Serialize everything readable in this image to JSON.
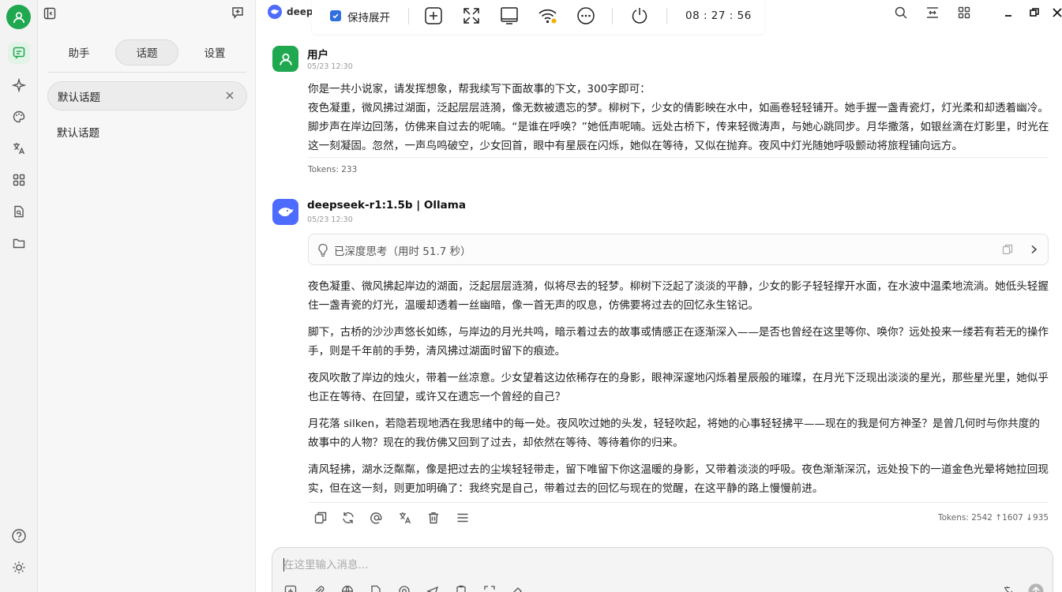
{
  "colors": {
    "accent_green": "#1fa84f",
    "accent_blue": "#2f6fde",
    "deepseek_blue": "#4d6bfe"
  },
  "header": {
    "tab_title": "deeps",
    "float_bar": {
      "keep_open_label": "保持展开",
      "keep_open_checked": true,
      "clock": "08 : 27 : 56"
    }
  },
  "sidebar": {
    "tabs": [
      {
        "label": "助手"
      },
      {
        "label": "话题",
        "active": true
      },
      {
        "label": "设置"
      }
    ],
    "topic_selected": "默认话题",
    "topics": [
      {
        "label": "默认话题"
      }
    ]
  },
  "messages": [
    {
      "sender": "用户",
      "time": "05/23 12:30",
      "paragraphs": [
        "你是一共小说家，请发挥想象，帮我续写下面故事的下文，300字即可：",
        "夜色凝重，微风拂过湖面，泛起层层涟漪，像无数被遗忘的梦。柳树下，少女的倩影映在水中，如画卷轻轻铺开。她手握一盏青瓷灯，灯光柔和却透着幽冷。脚步声在岸边回荡，仿佛来自过去的呢喃。“是谁在呼唤？”她低声呢喃。远处古桥下，传来轻微涛声，与她心跳同步。月华撒落，如银丝滴在灯影里，时光在这一刻凝固。忽然，一声鸟鸣破空，少女回首，眼中有星辰在闪烁，她似在等待，又似在抛弃。夜风中灯光随她呼吸颤动将旅程铺向远方。"
      ],
      "tokens": "Tokens: 233"
    },
    {
      "sender": "deepseek-r1:1.5b | Ollama",
      "time": "05/23 12:30",
      "thinking": "已深度思考（用时 51.7 秒）",
      "paragraphs": [
        "夜色凝重、微风拂起岸边的湖面，泛起层层涟漪，似将尽去的轻梦。柳树下泛起了淡淡的平静，少女的影子轻轻撑开水面，在水波中温柔地流淌。她低头轻握住一盏青瓷的灯光，温暖却透着一丝幽暗，像一首无声的叹息，仿佛要将过去的回忆永生铭记。",
        "脚下，古桥的沙沙声悠长如练，与岸边的月光共鸣，暗示着过去的故事或情感正在逐渐深入——是否也曾经在这里等你、唤你？远处投来一缕若有若无的操作手，则是千年前的手势，清风拂过湖面时留下的痕迹。",
        "夜风吹散了岸边的烛火，带着一丝凉意。少女望着这边依稀存在的身影，眼神深邃地闪烁着星辰般的璀璨，在月光下泛现出淡淡的星光，那些星光里，她似乎也正在等待、在回望，或许又在遗忘一个曾经的自己？",
        "月花落 silken，若隐若现地洒在我思绪中的每一处。夜风吹过她的头发，轻轻吹起，将她的心事轻轻拂平——现在的我是何方神圣？是曾几何时与你共度的故事中的人物？现在的我仿佛又回到了过去，却依然在等待、等待着你的归来。",
        "清风轻拂，湖水泛粼粼，像是把过去的尘埃轻轻带走，留下唯留下你这温暖的身影，又带着淡淡的呼吸。夜色渐渐深沉，远处投下的一道金色光晕将她拉回现实，但在这一刻，则更加明确了：我终究是自己，带着过去的回忆与现在的觉醒，在这平静的路上慢慢前进。"
      ],
      "tokens": "Tokens: 2542",
      "tokens_up": "↑1607",
      "tokens_down": "↓935"
    }
  ],
  "input": {
    "placeholder": "在这里输入消息..."
  }
}
